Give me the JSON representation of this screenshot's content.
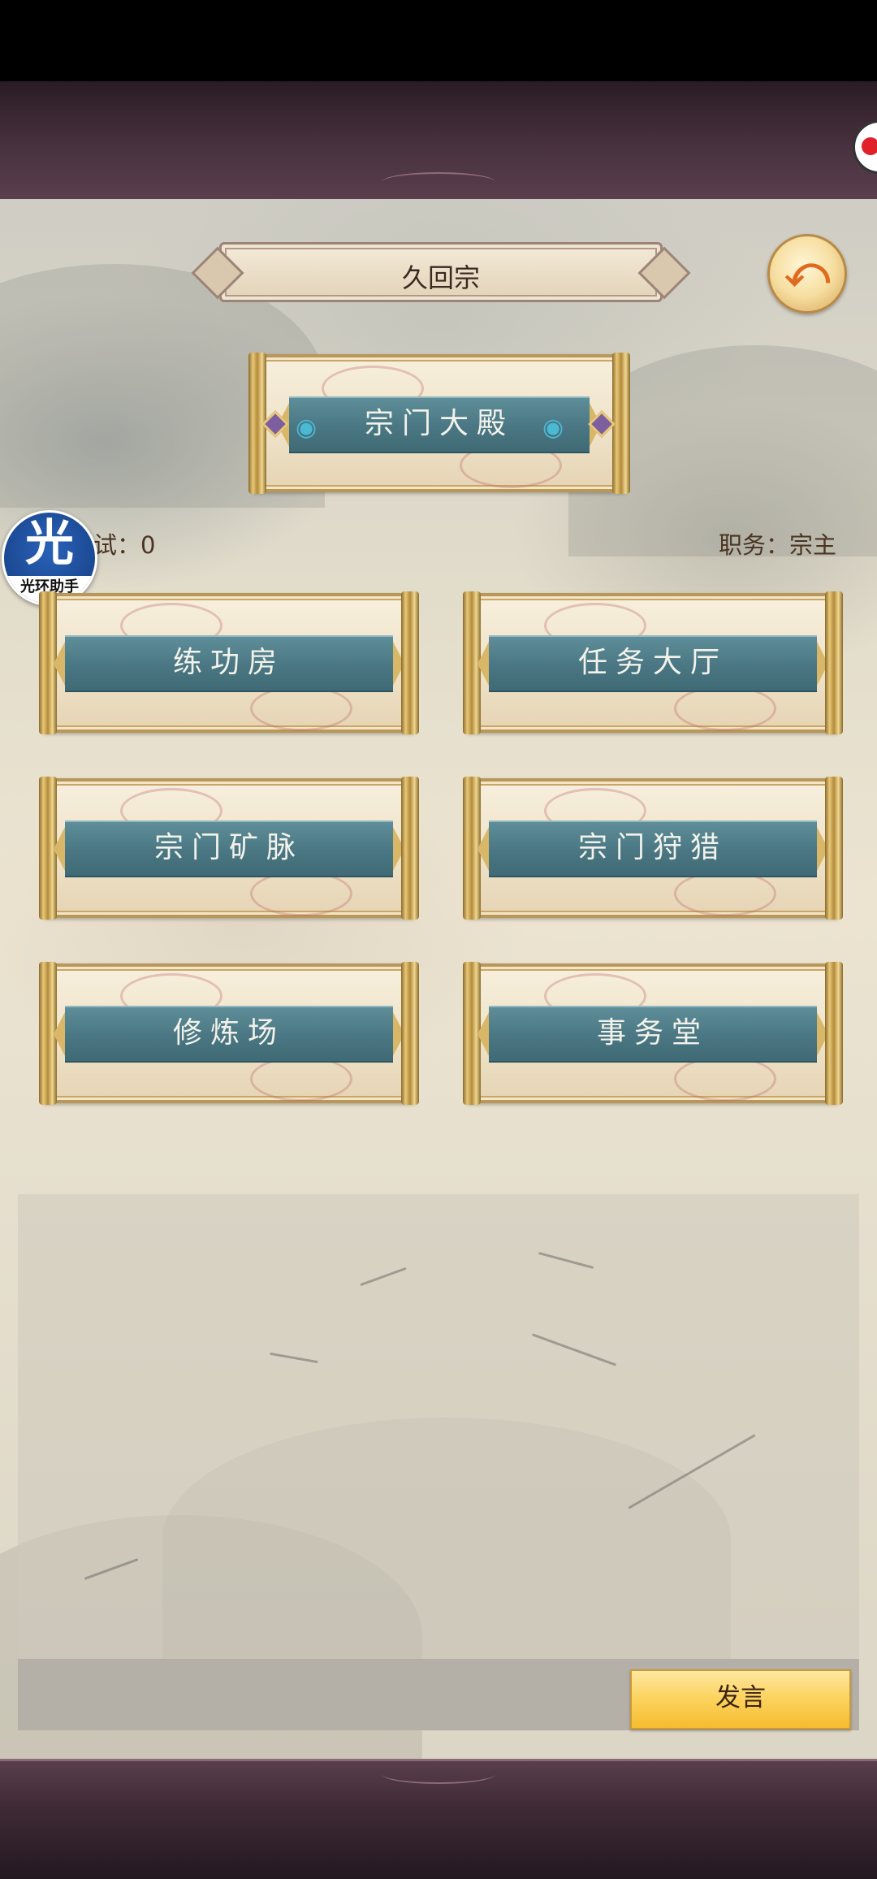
{
  "header": {
    "sect_name": "久回宗",
    "back_icon": "back-arrow-icon"
  },
  "hall": {
    "label": "宗门大殿",
    "side_icon": "fan-icon"
  },
  "info": {
    "left_text": "试：0",
    "right_text": "职务：宗主"
  },
  "buildings": [
    {
      "label": "练功房"
    },
    {
      "label": "任务大厅"
    },
    {
      "label": "宗门矿脉"
    },
    {
      "label": "宗门狩猎"
    },
    {
      "label": "修炼场"
    },
    {
      "label": "事务堂"
    }
  ],
  "helper": {
    "glyph": "光",
    "label": "光环助手"
  },
  "chat": {
    "send_label": "发言",
    "input_value": ""
  },
  "colors": {
    "banner": "#4b7884",
    "gold_frame": "#b9965a",
    "send_button": "#fcd25c",
    "frame": "#4a3340"
  }
}
